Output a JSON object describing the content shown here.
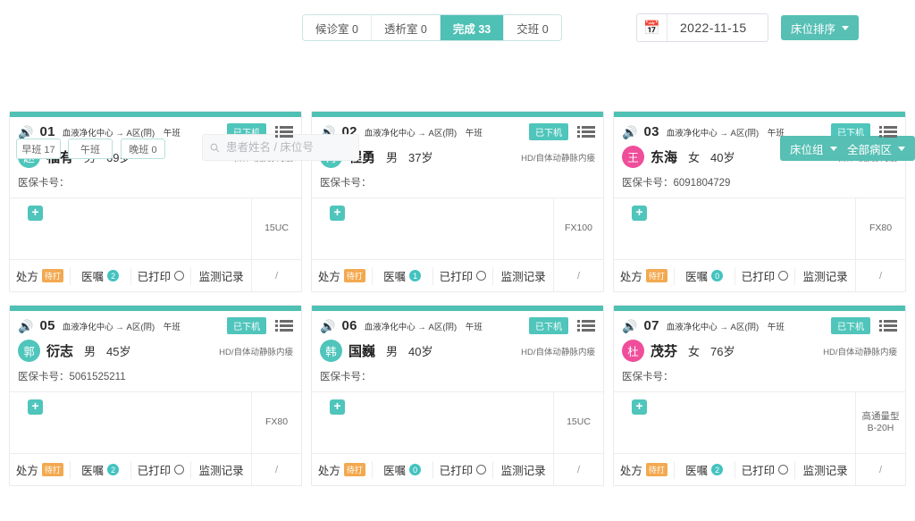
{
  "topbar": {
    "segments": [
      {
        "label": "候诊室 0",
        "active": false
      },
      {
        "label": "透析室 0",
        "active": false
      },
      {
        "label": "完成 33",
        "active": true
      },
      {
        "label": "交班 0",
        "active": false
      }
    ],
    "date_value": "2022-11-15",
    "calendar_icon": "calendar-icon",
    "sort_button": "床位排序"
  },
  "filterbar": {
    "shifts": [
      "早班 17",
      "午班",
      "晚班 0"
    ],
    "search_placeholder": "患者姓名 / 床位号",
    "search_value": "",
    "search_icon": "search-icon",
    "bed_group_button": "床位组",
    "ward_button": "全部病区"
  },
  "labels": {
    "insurance": "医保卡号：",
    "status_offline": "已下机",
    "act_prescription": "处方",
    "act_prescription_tag": "待打",
    "act_orders": "医嘱",
    "act_printed": "已打印",
    "act_monitor": "监测记录",
    "slash": "/"
  },
  "colors": {
    "accent": "#4fc0b4",
    "badge_teal": "#4fc5bb",
    "tag_orange": "#f3a950",
    "avatar_male": "#4fc5bb",
    "avatar_female": "#ef4e9b"
  },
  "cards": [
    {
      "bed": "01",
      "route": "血液净化中心 → A区(阴)",
      "shift": "午班",
      "status": "已下机",
      "avatar": "赵",
      "avatar_color": "#4fc5bb",
      "name": "福有",
      "sex": "男",
      "age": "69岁",
      "treatment": "HD/自体动静脉内瘘",
      "insurance": "",
      "orders_count": "2",
      "dialyzer": "15UC"
    },
    {
      "bed": "02",
      "route": "血液净化中心 → A区(阴)",
      "shift": "午班",
      "status": "已下机",
      "avatar": "冉",
      "avatar_color": "#4fc5bb",
      "name": "程勇",
      "sex": "男",
      "age": "37岁",
      "treatment": "HD/自体动静脉内瘘",
      "insurance": "",
      "orders_count": "1",
      "dialyzer": "FX100"
    },
    {
      "bed": "03",
      "route": "血液净化中心 → A区(阴)",
      "shift": "午班",
      "status": "已下机",
      "avatar": "王",
      "avatar_color": "#ef4e9b",
      "name": "东海",
      "sex": "女",
      "age": "40岁",
      "treatment": "HD/自体动静脉内瘘",
      "insurance": "6091804729",
      "orders_count": "0",
      "dialyzer": "FX80"
    },
    {
      "bed": "05",
      "route": "血液净化中心 → A区(阴)",
      "shift": "午班",
      "status": "已下机",
      "avatar": "郭",
      "avatar_color": "#4fc5bb",
      "name": "衍志",
      "sex": "男",
      "age": "45岁",
      "treatment": "HD/自体动静脉内瘘",
      "insurance": "5061525211",
      "orders_count": "2",
      "dialyzer": "FX80"
    },
    {
      "bed": "06",
      "route": "血液净化中心 → A区(阴)",
      "shift": "午班",
      "status": "已下机",
      "avatar": "韩",
      "avatar_color": "#4fc5bb",
      "name": "国巍",
      "sex": "男",
      "age": "40岁",
      "treatment": "HD/自体动静脉内瘘",
      "insurance": "",
      "orders_count": "0",
      "dialyzer": "15UC"
    },
    {
      "bed": "07",
      "route": "血液净化中心 → A区(阴)",
      "shift": "午班",
      "status": "已下机",
      "avatar": "杜",
      "avatar_color": "#ef4e9b",
      "name": "茂芬",
      "sex": "女",
      "age": "76岁",
      "treatment": "HD/自体动静脉内瘘",
      "insurance": "",
      "orders_count": "2",
      "dialyzer": "高通量型B-20H"
    }
  ]
}
